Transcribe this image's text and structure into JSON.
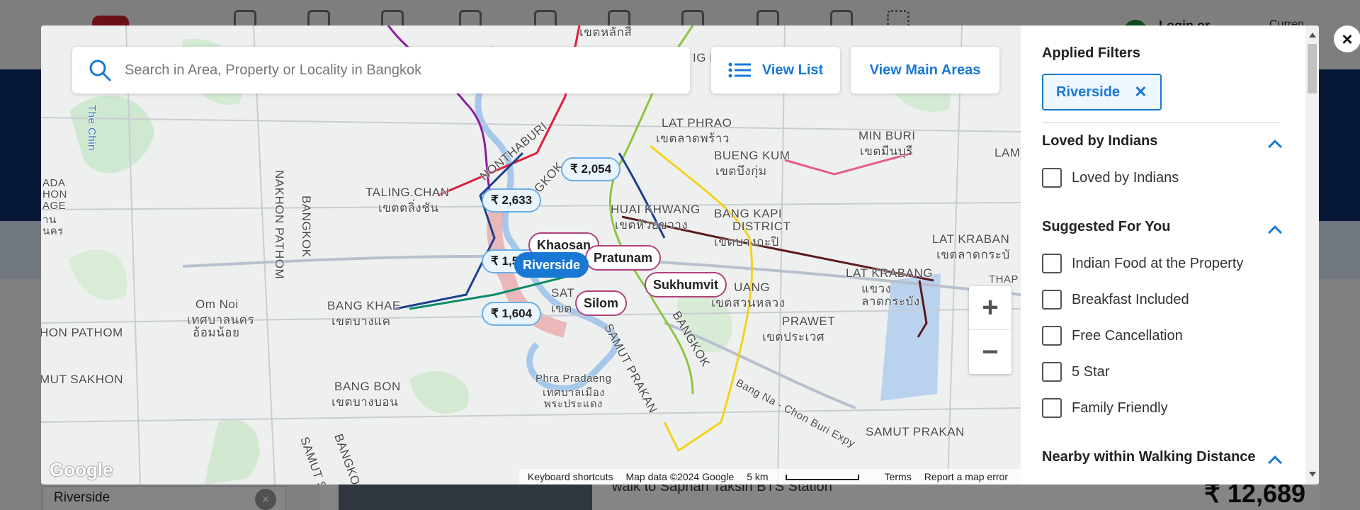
{
  "background": {
    "login_label": "Login or",
    "currency_label": "Curren",
    "filter_value": "Riverside",
    "filter_clear": "×",
    "card_text": "walk to Saphan Taksin BTS Station",
    "price": "₹ 12,689"
  },
  "search": {
    "placeholder": "Search in Area, Property or Locality in Bangkok"
  },
  "buttons": {
    "view_list": "View List",
    "view_main_areas": "View Main Areas",
    "close": "×",
    "zoom_in": "+",
    "zoom_out": "−"
  },
  "map": {
    "labels": {
      "khet_lak_si": "เขตหลักสี่",
      "lat_phrao": "LAT PHRAO",
      "lat_phrao_th": "เขตลาดพร้าว",
      "bueng_kum": "BUENG KUM",
      "bueng_kum_th": "เขตบึงกุ่ม",
      "min_buri": "MIN BURI",
      "min_buri_th": "เขตมีนบุรี",
      "lam": "LAM",
      "nonthaburi": "NONTHABURI",
      "bangkok_n": "BANGKOK",
      "taling_chan": "TALING.CHAN",
      "taling_chan_th": "เขตตลิ่งชัน",
      "huai_khwang": "HUAI KHWANG",
      "huai_khwang_th": "เขตห้วยขวาง",
      "bang_kapi": "BANG KAPI",
      "district": "DISTRICT",
      "bang_kapi_th": "เขตบางกะปิ",
      "lat_krabang_upper": "LAT KRABAN",
      "lat_krabang_upper_th": "เขตลาดกระบั",
      "lat_krabang": "LAT KRABANG",
      "lat_krabang_th": "แขวง",
      "lat_krabang_th2": "ลาดกระบัง",
      "thap": "THAP",
      "nakhon_pathom_v": "NAKHON PATHOM",
      "bangkok_v": "BANGKOK",
      "om_noi": "Om Noi",
      "om_noi_th": "เทศบาลนคร",
      "om_noi_th2": "อ้อมน้อย",
      "hon_pathom": "HON PATHOM",
      "mut_sakhon": "MUT SAKHON",
      "bang_khae": "BANG KHAE",
      "bang_khae_th": "เขตบางแค",
      "bang_bon": "BANG BON",
      "bang_bon_th": "เขตบางบอน",
      "phra_pradaeng": "Phra Pradaeng",
      "phra_pradaeng_th": "เทศบาลเมือง",
      "phra_pradaeng_th2": "พระประแดง",
      "samut_prakan_diag": "SAMUT PRAKAN",
      "samut_prakan": "SAMUT PRAKAN",
      "prawet": "PRAWET",
      "prawet_th": "เขตประเวศ",
      "suan_luang": "UANG",
      "suan_luang_th": "เขตสวนหลวง",
      "bangkok_diag": "BANGKOK",
      "bang_na_road": "Bang Na - Chon Buri Expy",
      "the_chin": "The Chin",
      "sat": "SAT",
      "sat_th": "เขต",
      "left_edge": "ADA",
      "left_edge2": "HON",
      "left_edge3": "AGE",
      "left_edge4": "าน",
      "left_edge5": "นคร",
      "khet_lak_si_top": "เขตหลักสี่",
      "top_dup": "เขตหลักสี่",
      "samut_s": "SAMUT S",
      "bangko_v": "BANGKO",
      "ig_k": "IG K"
    },
    "price_pins": [
      "₹ 2,054",
      "₹ 2,633",
      "₹ 1,5",
      "₹ 1,604"
    ],
    "area_pins": {
      "khaosan": "Khaosan",
      "riverside": "Riverside",
      "pratunam": "Pratunam",
      "sukhumvit": "Sukhumvit",
      "silom": "Silom"
    },
    "google": "Google",
    "attribution": {
      "keyboard": "Keyboard shortcuts",
      "data": "Map data ©2024 Google",
      "scale": "5 km",
      "terms": "Terms",
      "report": "Report a map error"
    }
  },
  "filters": {
    "applied_title": "Applied Filters",
    "applied": [
      {
        "label": "Riverside",
        "remove": "✕"
      }
    ],
    "sections": [
      {
        "title": "Loved by Indians",
        "options": [
          "Loved by Indians"
        ]
      },
      {
        "title": "Suggested For You",
        "options": [
          "Indian Food at the Property",
          "Breakfast Included",
          "Free Cancellation",
          "5 Star",
          "Family Friendly"
        ]
      },
      {
        "title": "Nearby within Walking Distance",
        "options": []
      }
    ]
  },
  "colors": {
    "accent": "#1978d4",
    "area_pin_border": "#b0407a",
    "price_pin_border": "#6aaee8"
  }
}
